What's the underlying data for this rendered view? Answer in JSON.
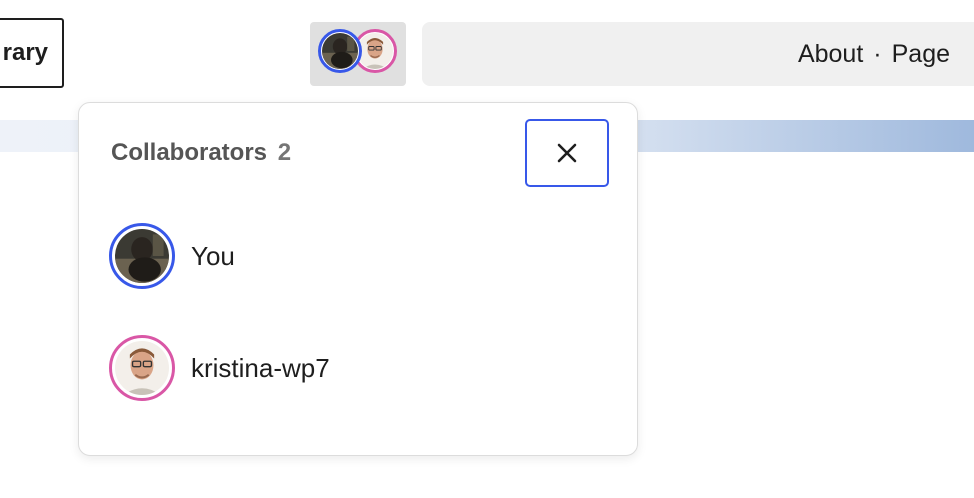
{
  "toolbar": {
    "library_label": "rary",
    "doc_title": "About",
    "doc_separator": "·",
    "doc_type": "Page"
  },
  "collaborators_popover": {
    "title": "Collaborators",
    "count": "2",
    "close_icon": "close-icon",
    "items": [
      {
        "name": "You",
        "ring_color": "#3858e9"
      },
      {
        "name": "kristina-wp7",
        "ring_color": "#d957a6"
      }
    ]
  },
  "colors": {
    "accent": "#3858e9",
    "collaborator_pink": "#d957a6"
  }
}
